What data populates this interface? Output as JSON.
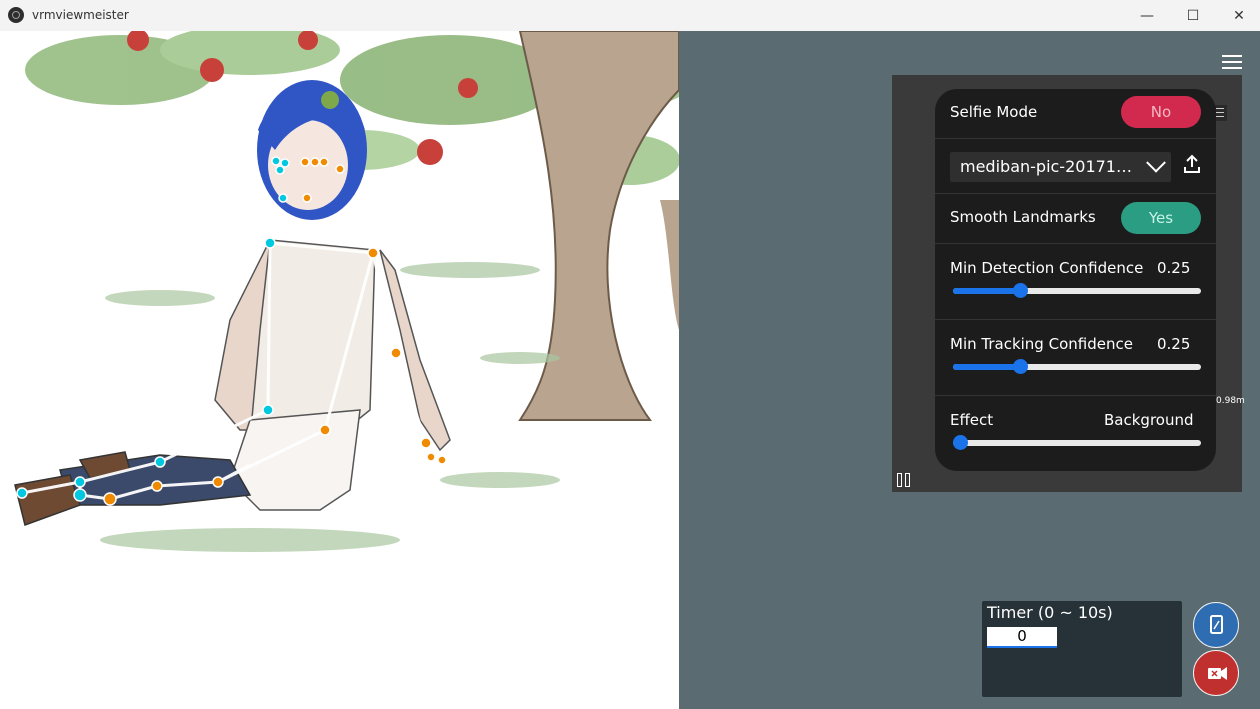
{
  "window": {
    "title": "vrmviewmeister",
    "controls": {
      "minimize": "—",
      "maximize": "☐",
      "close": "✕"
    }
  },
  "panel": {
    "selfie_mode": {
      "label": "Selfie Mode",
      "value": "No"
    },
    "source": {
      "selected": "mediban-pic-20171…"
    },
    "smooth_landmarks": {
      "label": "Smooth Landmarks",
      "value": "Yes"
    },
    "min_detection": {
      "label": "Min Detection Confidence",
      "value": "0.25",
      "fraction": 0.27
    },
    "min_tracking": {
      "label": "Min Tracking Confidence",
      "value": "0.25",
      "fraction": 0.27
    },
    "effect": {
      "label": "Effect",
      "value": "Background",
      "fraction": 0.0
    }
  },
  "preview": {
    "distance": "0.98m"
  },
  "timer": {
    "label": "Timer (0 ~ 10s)",
    "value": "0"
  },
  "colors": {
    "accent": "#1a73e8",
    "no": "#d22a4f",
    "yes": "#2a9d82",
    "landmark_left": "#00c8e0",
    "landmark_right": "#f08a00",
    "fab_blue": "#2f6db3",
    "fab_red": "#c0302e"
  }
}
